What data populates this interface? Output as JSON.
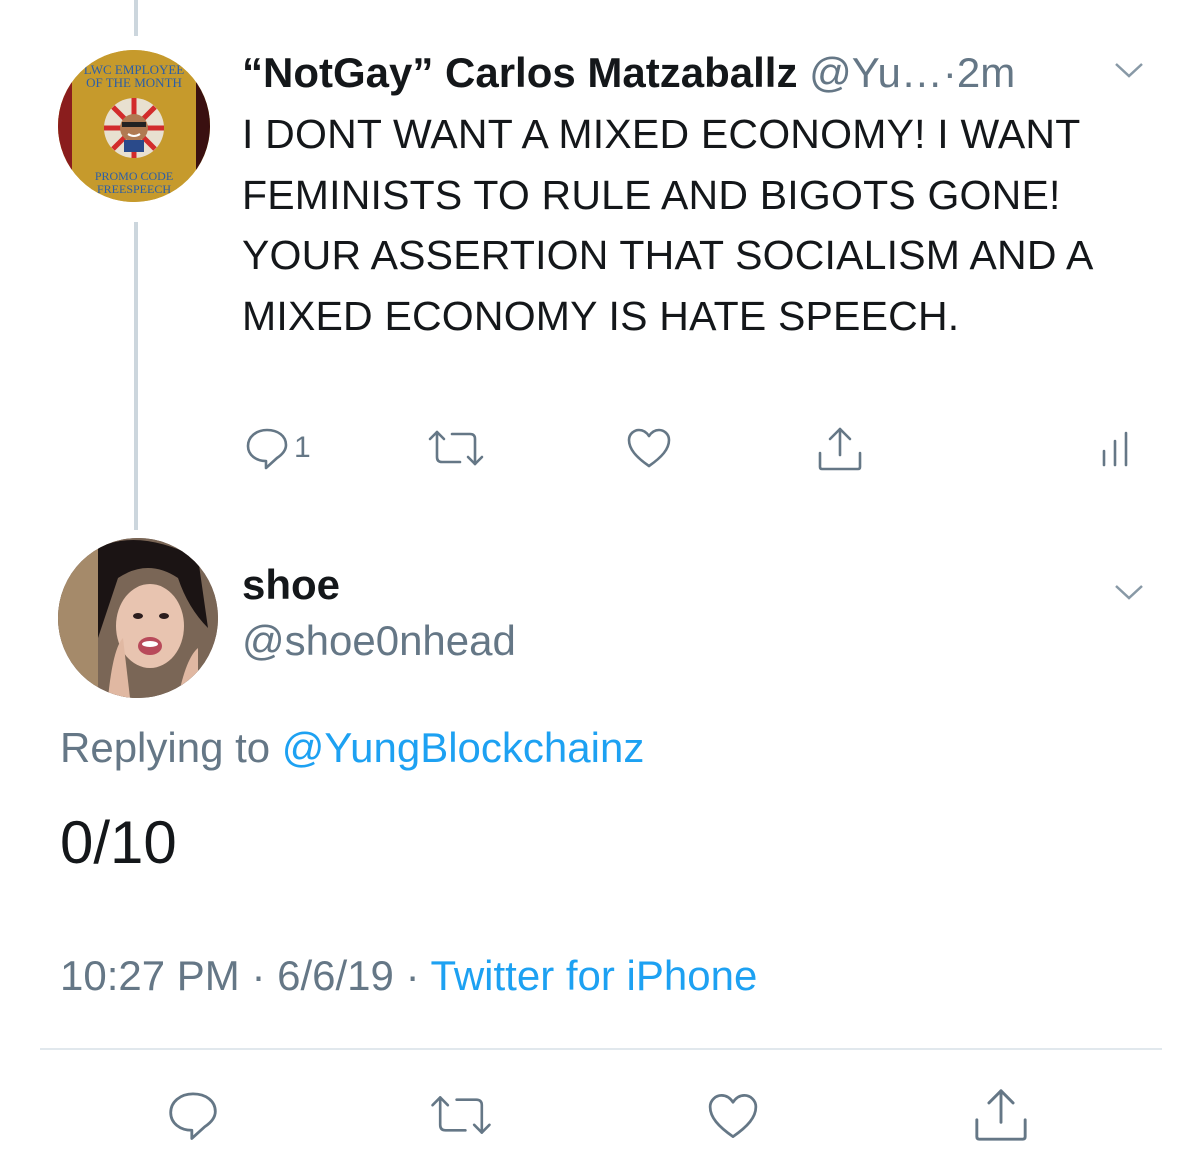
{
  "parent_tweet": {
    "display_name": "“NotGay” Carlos Matzaballz",
    "handle_truncated": "@Yu…",
    "separator": "·",
    "relative_time": "2m",
    "text": "I DONT WANT A MIXED ECONOMY! I WANT FEMINISTS TO RULE AND BIGOTS GONE! YOUR ASSERTION THAT SOCIALISM AND A MIXED ECONOMY IS HATE SPEECH.",
    "reply_count": "1",
    "avatar_text": {
      "top_line_1": "LWC EMPLOYEE",
      "top_line_2": "OF THE MONTH",
      "bottom_line_1": "PROMO CODE",
      "bottom_line_2": "FREESPEECH"
    },
    "icons": {
      "reply": "reply-icon",
      "retweet": "retweet-icon",
      "like": "like-icon",
      "share": "share-icon",
      "analytics": "analytics-icon",
      "menu": "chevron-down-icon"
    }
  },
  "main_tweet": {
    "display_name": "shoe",
    "handle": "@shoe0nhead",
    "replying_prefix": "Replying to",
    "replying_to": "@YungBlockchainz",
    "text": "0/10",
    "time": "10:27 PM",
    "separator_1": "·",
    "date": "6/6/19",
    "separator_2": "·",
    "source": "Twitter for iPhone",
    "icons": {
      "reply": "reply-icon",
      "retweet": "retweet-icon",
      "like": "like-icon",
      "share": "share-icon",
      "menu": "chevron-down-icon"
    }
  },
  "colors": {
    "text_primary": "#14171a",
    "text_secondary": "#657786",
    "link": "#1da1f2",
    "thread_line": "#ccd6dd",
    "divider": "#e1e8ed"
  }
}
